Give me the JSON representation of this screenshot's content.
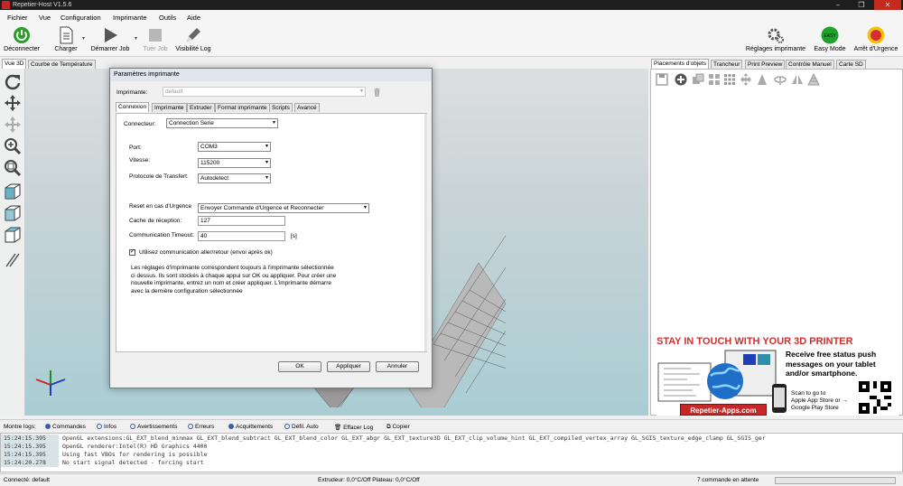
{
  "window": {
    "title": "Repetier-Host V1.5.6"
  },
  "menu": [
    "Fichier",
    "Vue",
    "Configuration",
    "Imprimante",
    "Outils",
    "Aide"
  ],
  "toolbar": {
    "disconnect": "Déconnecter",
    "load": "Charger",
    "start_job": "Démarrer Job",
    "kill_job": "Tuer Job",
    "show_log": "Visibilité Log",
    "printer_settings": "Réglages imprimante",
    "easy_mode": "Easy Mode",
    "easy_badge": "EASY",
    "emergency": "Arrêt d'Urgence"
  },
  "left_tabs": [
    "Vue 3D",
    "Courbe de Température"
  ],
  "right_tabs": [
    "Placements d'objets",
    "Trancheur",
    "Print Preview",
    "Contrôle Manuel",
    "Carte SD"
  ],
  "dialog": {
    "title": "Paramètres imprimante",
    "printer_label": "Imprimante:",
    "printer_value": "default",
    "tabs": [
      "Connexion",
      "Imprimante",
      "Extruder",
      "Format imprimante",
      "Scripts",
      "Avancé"
    ],
    "connector_label": "Connecteur:",
    "connector_value": "Connection Serie",
    "port_label": "Port:",
    "port_value": "COM3",
    "speed_label": "Vitesse:",
    "speed_value": "115200",
    "protocol_label": "Protocole de Transfert:",
    "protocol_value": "Autodetect",
    "reset_label": "Reset en cas d'Urgence",
    "reset_value": "Envoyer Commande d'Urgence et Reconnecter",
    "cache_label": "Cache de réception:",
    "cache_value": "127",
    "timeout_label": "Communication Timeout:",
    "timeout_value": "40",
    "timeout_unit": "[s]",
    "pingpong_label": "Utilisez communication aller/retour (envoi après ok)",
    "info_lines": [
      "Les réglages d'imprimante correspondent toujours à l'imprimante sélectionnée",
      "ci dessus. Ils sont stockés à chaque appui sur OK ou appliquer. Pour créer une",
      "nouvelle imprimante, entrez un nom et créer appliquer. L'imprimante démarre",
      "avec la dernière configuration sélectionnée"
    ],
    "ok": "OK",
    "apply": "Appliquer",
    "cancel": "Annuler"
  },
  "ad": {
    "headline": "STAY IN TOUCH WITH YOUR 3D PRINTER",
    "body_lines": [
      "Receive free status push",
      "messages on your tablet",
      "and/or smartphone."
    ],
    "scan_lines": [
      "Scan to go to",
      "Apple App Store or →",
      "Google Play Store"
    ],
    "badge": "Repetier-Apps.com"
  },
  "logbar": {
    "label": "Montre logs:",
    "options": [
      {
        "label": "Commandes",
        "on": true
      },
      {
        "label": "Infos",
        "on": false
      },
      {
        "label": "Avertissements",
        "on": false
      },
      {
        "label": "Erreurs",
        "on": false
      },
      {
        "label": "Acquittements",
        "on": true
      },
      {
        "label": "Défil. Auto",
        "on": false
      }
    ],
    "clear": "Effacer Log",
    "copy": "Copier"
  },
  "log": [
    {
      "t": "15:24:15.395",
      "m": "OpenGL extensions:GL_EXT_blend_minmax GL_EXT_blend_subtract GL_EXT_blend_color GL_EXT_abgr GL_EXT_texture3D GL_EXT_clip_volume_hint GL_EXT_compiled_vertex_array GL_SGIS_texture_edge_clamp GL_SGIS_ger"
    },
    {
      "t": "15:24:15.395",
      "m": "OpenGL renderer:Intel(R) HD Graphics 4400"
    },
    {
      "t": "15:24:15.395",
      "m": "Using fast VBOs for rendering is possible"
    },
    {
      "t": "15:24:20.278",
      "m": "No start signal detected - forcing start"
    }
  ],
  "status": {
    "connected": "Connecté: default",
    "temps": "Extrudeur: 0,0°C/Off Plateau: 0,0°C/Off",
    "queue": "7 commande en attente"
  },
  "colors": {
    "accent": "#3a5da8",
    "power": "#2e9d2e",
    "easy": "#1fa12b",
    "emergency": "#d32f2f",
    "ad_red": "#d32f2f"
  }
}
